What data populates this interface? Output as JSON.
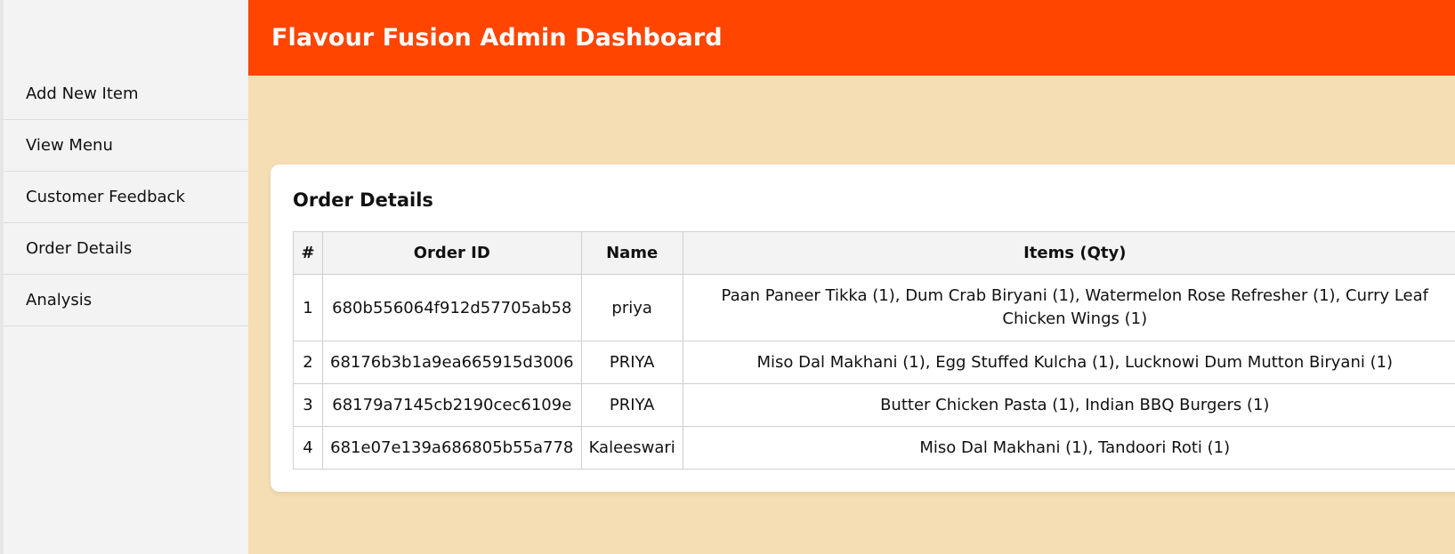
{
  "header": {
    "title": "Flavour Fusion Admin Dashboard"
  },
  "sidebar": {
    "items": [
      {
        "label": "Add New Item"
      },
      {
        "label": "View Menu"
      },
      {
        "label": "Customer Feedback"
      },
      {
        "label": "Order Details"
      },
      {
        "label": "Analysis"
      }
    ]
  },
  "orders": {
    "title": "Order Details",
    "columns": [
      "#",
      "Order ID",
      "Name",
      "Items (Qty)"
    ],
    "rows": [
      {
        "num": "1",
        "id": "680b556064f912d57705ab58",
        "name": "priya",
        "items": "Paan Paneer Tikka (1), Dum Crab Biryani (1), Watermelon Rose Refresher (1), Curry Leaf Chicken Wings (1)"
      },
      {
        "num": "2",
        "id": "68176b3b1a9ea665915d3006",
        "name": "PRIYA",
        "items": "Miso Dal Makhani (1), Egg Stuffed Kulcha (1), Lucknowi Dum Mutton Biryani (1)"
      },
      {
        "num": "3",
        "id": "68179a7145cb2190cec6109e",
        "name": "PRIYA",
        "items": "Butter Chicken Pasta (1), Indian BBQ Burgers (1)"
      },
      {
        "num": "4",
        "id": "681e07e139a686805b55a778",
        "name": "Kaleeswari",
        "items": "Miso Dal Makhani (1), Tandoori Roti (1)"
      }
    ]
  }
}
